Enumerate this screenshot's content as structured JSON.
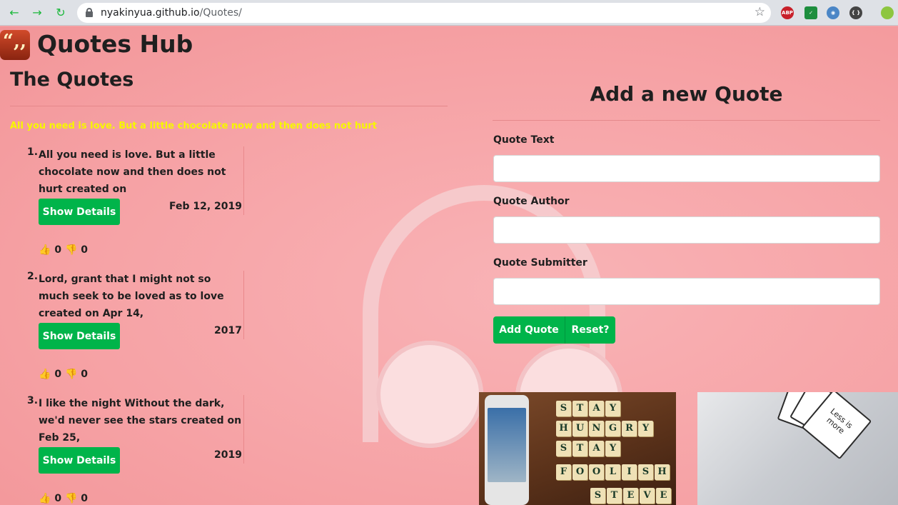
{
  "browser": {
    "url_host": "nyakinyua.github.io",
    "url_path": "/Quotes/",
    "extensions": [
      "ABP"
    ]
  },
  "header": {
    "site_title": "Quotes Hub"
  },
  "quotes_section": {
    "title": "The Quotes",
    "featured_quote": "All you need is love. But a little chocolate now and then does not hurt",
    "items": [
      {
        "num": "1.",
        "text": "All you need is love. But a little chocolate now and then does not hurt created on",
        "date": "Feb 12, 2019",
        "button": "Show Details",
        "upvotes": "0",
        "downvotes": "0"
      },
      {
        "num": "2.",
        "text": "Lord, grant that I might not so much seek to be loved as to love created on Apr 14,",
        "date": "2017",
        "button": "Show Details",
        "upvotes": "0",
        "downvotes": "0"
      },
      {
        "num": "3.",
        "text": "I like the night Without the dark, we'd never see the stars created on Feb 25,",
        "date": "2019",
        "button": "Show Details",
        "upvotes": "0",
        "downvotes": "0"
      }
    ]
  },
  "form": {
    "title": "Add a new Quote",
    "fields": [
      {
        "label": "Quote Text",
        "value": ""
      },
      {
        "label": "Quote Author",
        "value": ""
      },
      {
        "label": "Quote Submitter",
        "value": ""
      }
    ],
    "add_button": "Add Quote",
    "reset_button": "Reset?"
  },
  "images": {
    "scrabble_rows": [
      "STAY",
      "HUNGRY",
      "STAY",
      "FOOLISH",
      "STEVE"
    ],
    "card_text": "Less is more"
  },
  "colors": {
    "accent_green": "#00b44a",
    "featured_yellow": "#f7f700",
    "page_pink": "#f7a6a9"
  }
}
